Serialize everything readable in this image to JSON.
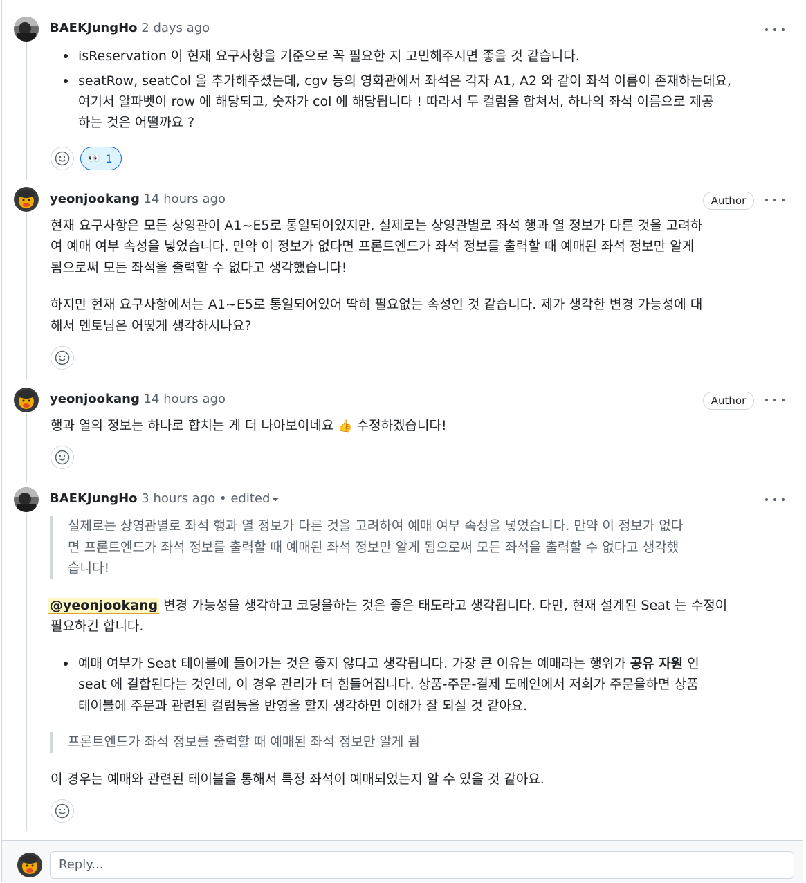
{
  "comments": [
    {
      "author": "BAEKJungHo",
      "time": "2 days ago",
      "bullets": [
        {
          "lines": [
            "isReservation 이 현재 요구사항을 기준으로 꼭 필요한 지 고민해주시면 좋을 것 같습니다."
          ]
        },
        {
          "lines": [
            "seatRow, seatCol 을 추가해주셨는데, cgv 등의 영화관에서 좌석은 각자 A1, A2 와 같이 좌석 이름이 존재하는데요,",
            "여기서 알파벳이 row 에 해당되고, 숫자가 col 에 해당됩니다 ! 따라서 두 컬럼을 합쳐서, 하나의 좌석 이름으로 제공",
            "하는 것은 어떨까요 ?"
          ]
        }
      ],
      "reaction": {
        "icon": "eyes-emoji",
        "glyph": "👀",
        "count": "1"
      }
    },
    {
      "author": "yeonjookang",
      "time": "14 hours ago",
      "badge": "Author",
      "para1": [
        "현재 요구사항은 모든 상영관이 A1~E5로 통일되어있지만, 실제로는 상영관별로 좌석 행과 열 정보가 다른 것을 고려하",
        "여 예매 여부 속성을 넣었습니다. 만약 이 정보가 없다면 프론트엔드가 좌석 정보를 출력할 때 예매된 좌석 정보만 알게",
        "됨으로써 모든 좌석을 출력할 수 없다고 생각했습니다!"
      ],
      "para2": [
        "하지만 현재 요구사항에서는 A1~E5로 통일되어있어 딱히 필요없는 속성인 것 같습니다. 제가 생각한 변경 가능성에 대",
        "해서 멘토님은 어떻게 생각하시나요?"
      ]
    },
    {
      "author": "yeonjookang",
      "time": "14 hours ago",
      "badge": "Author",
      "text_before": "행과 열의 정보는 하나로 합치는 게 더 나아보이네요 ",
      "emoji": "👍",
      "text_after": " 수정하겠습니다!"
    },
    {
      "author": "BAEKJungHo",
      "time": "3 hours ago",
      "edited": "• edited",
      "quote1": [
        "실제로는 상영관별로 좌석 행과 열 정보가 다른 것을 고려하여 예매 여부 속성을 넣었습니다. 만약 이 정보가 없다",
        "면 프론트엔드가 좌석 정보를 출력할 때 예매된 좌석 정보만 알게 됨으로써 모든 좌석을 출력할 수 없다고 생각했",
        "습니다!"
      ],
      "mention": "@yeonjookang",
      "mention_rest_line1": " 변경 가능성을 생각하고 코딩을하는 것은 좋은 태도라고 생각됩니다. 다만, 현재 설계된 Seat 는 수정이",
      "mention_line2": "필요하긴 합니다.",
      "bullet_line1_before": "예매 여부가 Seat 테이블에 들어가는 것은 좋지 않다고 생각됩니다. 가장 큰 이유는 예매라는 행위가 ",
      "bullet_bold": "공유 자원",
      "bullet_line1_after": " 인",
      "bullet_line2": "seat 에 결합된다는 것인데, 이 경우 관리가 더 힘들어집니다. 상품-주문-결제 도메인에서 저희가 주문을하면 상품",
      "bullet_line3": "테이블에 주문과 관련된 컬럼등을 반영을 할지 생각하면 이해가 잘 되실 것 같아요.",
      "quote2": "프론트엔드가 좌석 정보를 출력할 때 예매된 좌석 정보만 알게 됨",
      "closing": "이 경우는 예매와 관련된 테이블을 통해서 특정 좌석이 예매되었는지 알 수 있을 것 같아요."
    }
  ],
  "reply": {
    "placeholder": "Reply..."
  }
}
